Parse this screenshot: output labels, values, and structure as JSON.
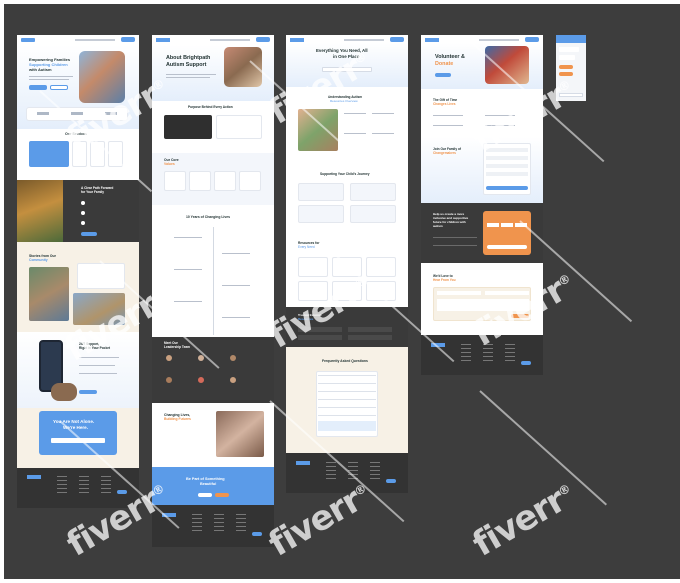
{
  "colors": {
    "board": "#3d3d3d",
    "accent_blue": "#5b9be8",
    "accent_orange": "#f0944d",
    "dark_footer": "#333333",
    "cream": "#f7f1e6",
    "light_blue": "#e3eefb"
  },
  "page1": {
    "hero_title_1": "Empowering Families",
    "hero_title_2": "Supporting Children",
    "hero_title_3": "with Autism",
    "services_title": "Our Services",
    "dark_title": "A Clear Path Forward",
    "dark_title_2": "for Your Family",
    "community_title": "Stories from Our",
    "community_title_2": "Community",
    "support_title": "24/7 Support,",
    "support_title_2": "Right in Your Pocket",
    "cta_title": "You Are Not Alone.",
    "cta_title_2": "We're Here."
  },
  "page2": {
    "hero_title": "About Brightpath",
    "hero_title_2": "Autism Support",
    "purpose_title": "Purpose Behind Every Action",
    "values_title": "Our Core",
    "values_title_2": "Values",
    "years_title": "10 Years of Changing Lives",
    "team_title": "Meet Our",
    "team_title_2": "Leadership Team",
    "change_title": "Changing Lives,",
    "change_title_2": "Building Futures",
    "cta_title": "Be Part of Something",
    "cta_title_2": "Beautiful"
  },
  "page3": {
    "hero_title": "Everything You Need, All",
    "hero_title_2": "in One Place",
    "understand_title": "Understanding Autism",
    "understand_sub": "Resources Overview",
    "journey_title": "Supporting Your Child's Journey",
    "resources_title": "Resources for",
    "resources_title_2": "Every Need",
    "trusted_title": "Trusted External",
    "trusted_title_2": "Resources",
    "faq_title": "Frequently Asked Questions"
  },
  "page4": {
    "hero_title": "Volunteer &",
    "hero_title_2": "Donate",
    "gift_title": "The Gift of Time",
    "gift_title_2": "Changes Lives",
    "join_title": "Join Our Family of",
    "join_title_2": "Changemakers",
    "dark_title": "Help us create a more",
    "dark_title_2": "inclusive and supportive",
    "dark_title_3": "future for children with",
    "dark_title_4": "autism",
    "hear_title": "We'd Love to",
    "hear_title_2": "Hear From You"
  },
  "watermark": "fiverr"
}
